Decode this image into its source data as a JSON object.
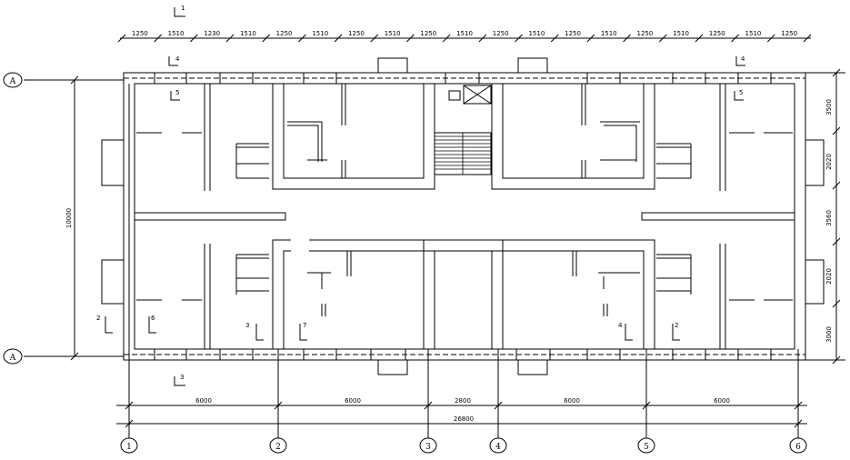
{
  "plan": {
    "top_dims": [
      "1250",
      "1510",
      "1230",
      "1510",
      "1250",
      "1510",
      "1250",
      "1510",
      "1250",
      "1510",
      "1250",
      "1510",
      "1250",
      "1510",
      "1250",
      "1510",
      "1250",
      "1510",
      "1250"
    ],
    "right_dims": [
      "3500",
      "2020",
      "3560",
      "2020",
      "3000"
    ],
    "left_total": "10000",
    "bottom_dims": [
      "6000",
      "6000",
      "2800",
      "6000",
      "6000"
    ],
    "bottom_total": "26800",
    "axis_labels": [
      "1",
      "2",
      "3",
      "4",
      "5",
      "6"
    ],
    "row_labels": [
      "A",
      "A"
    ],
    "section_marks": [
      "1",
      "2",
      "3",
      "4",
      "5",
      "6",
      "7"
    ]
  }
}
